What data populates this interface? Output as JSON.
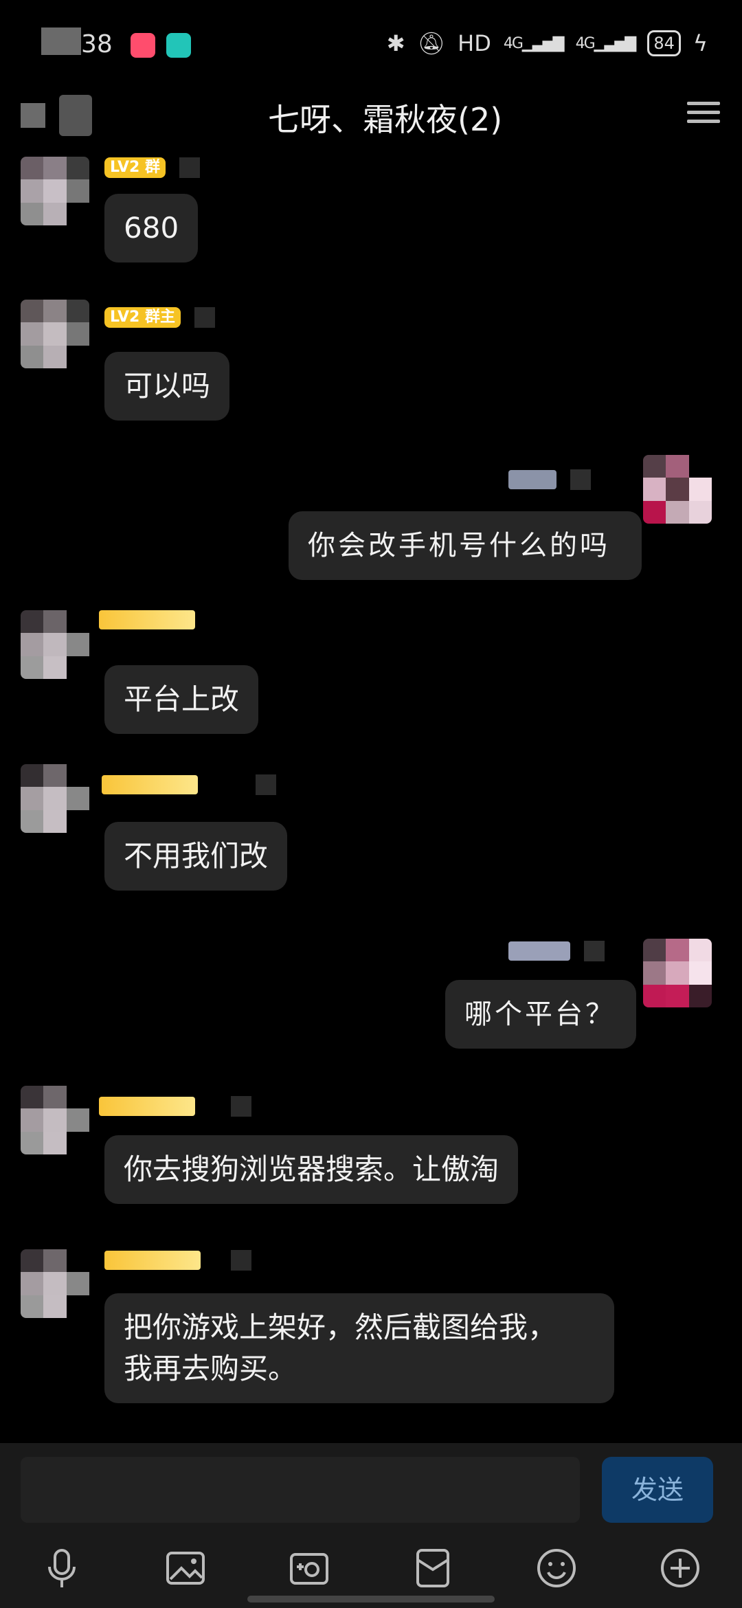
{
  "status_bar": {
    "time_partial": "38",
    "battery": "84",
    "hd_label": "HD",
    "network_1": "4G",
    "network_2": "4G"
  },
  "header": {
    "title": "七呀、霜秋夜(2)"
  },
  "messages": [
    {
      "side": "left",
      "badge": "LV2 群",
      "text": "680"
    },
    {
      "side": "left",
      "badge": "LV2 群主",
      "text": "可以吗"
    },
    {
      "side": "right",
      "badge": "",
      "text": "你会改手机号什么的吗"
    },
    {
      "side": "left",
      "badge": "",
      "text": "平台上改"
    },
    {
      "side": "left",
      "badge": "",
      "text": "不用我们改"
    },
    {
      "side": "right",
      "badge": "",
      "text": "哪个平台？"
    },
    {
      "side": "left",
      "badge": "",
      "text": "你去搜狗浏览器搜索。让傲淘"
    },
    {
      "side": "left",
      "badge": "",
      "text": "把你游戏上架好，然后截图给我，\n我再去购买。"
    }
  ],
  "input": {
    "placeholder": "",
    "send_label": "发送"
  },
  "toolbar": {
    "icons": [
      "microphone-icon",
      "image-icon",
      "camera-icon",
      "red-packet-icon",
      "emoji-icon",
      "plus-icon"
    ]
  },
  "colors": {
    "background": "#000000",
    "bubble": "#262626",
    "send_button": "#0e3a66",
    "badge": "#f6c324"
  }
}
